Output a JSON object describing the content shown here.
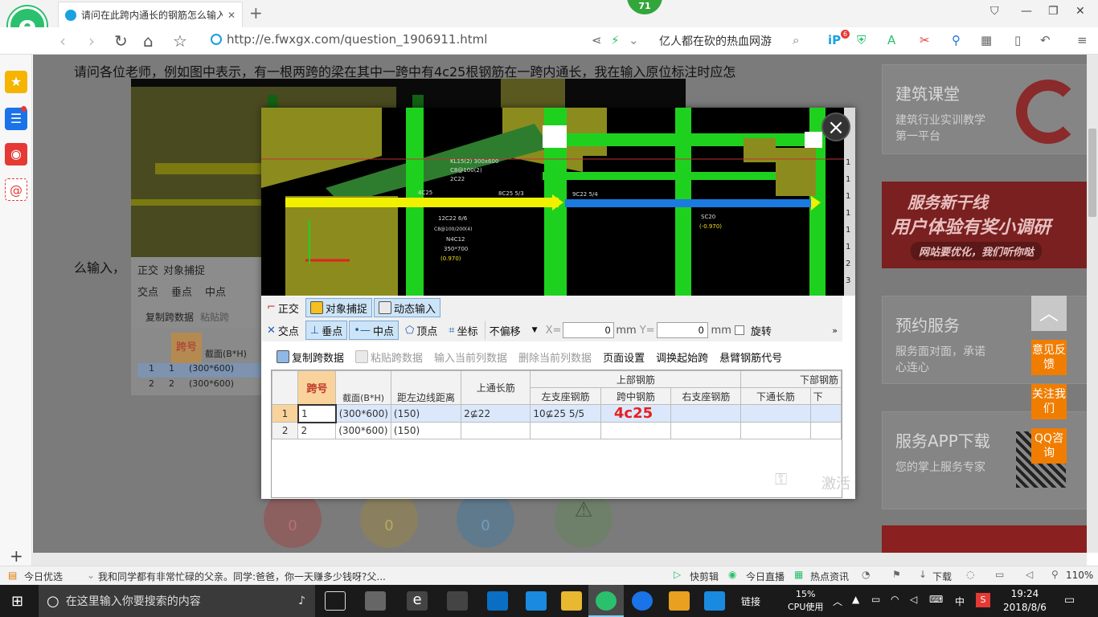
{
  "browser": {
    "tab_title": "请问在此跨内通长的钢筋怎么输入",
    "badge": "71",
    "url": "http://e.fwxgx.com/question_1906911.html",
    "search_text": "亿人都在砍的热血网游",
    "notif_count": "6"
  },
  "page": {
    "question_line": "请问各位老师，例如图中表示，有一根两跨的梁在其中一跨中有4c25根钢筋在一跨内通长，我在输入原位标注时应怎",
    "question_cont": "么输入，"
  },
  "right_panel": {
    "card1_title": "建筑课堂",
    "card1_desc": "建筑行业实训教学第一平台",
    "banner_title": "服务新干线",
    "banner_sub": "用户体验有奖小调研",
    "banner_tag": "网站要优化，我们听你哒",
    "card2_title": "预约服务",
    "card2_desc": "服务面对面，承诺心连心",
    "card3_title": "服务APP下载",
    "card3_desc": "您的掌上服务专家",
    "btn_feedback": "意见反馈",
    "btn_follow": "关注我们",
    "btn_qq": "QQ咨询"
  },
  "cad": {
    "labels": [
      "KL15(2) 300x600",
      "C8@100(2)",
      "2C22",
      "12C22 6/6",
      "C8@100/200(4)",
      "N4C12",
      "350*700",
      "(0.970)",
      "8C25 5/3",
      "9C22 5/4",
      "SC20",
      "(-0.970)",
      "4C25"
    ]
  },
  "toolbar1": {
    "ortho": "正交",
    "snap": "对象捕捉",
    "dyn": "动态输入"
  },
  "toolbar2": {
    "intersect": "交点",
    "perp": "垂点",
    "mid": "中点",
    "vertex": "顶点",
    "coord": "坐标",
    "offset": "不偏移",
    "x_label": "X=",
    "x_value": "0",
    "y_label": "Y=",
    "y_value": "0",
    "unit": "mm",
    "rotate": "旋转"
  },
  "toolbar3": {
    "copy": "复制跨数据",
    "paste": "粘贴跨数据",
    "input_col": "输入当前列数据",
    "delete_col": "删除当前列数据",
    "page_setup": "页面设置",
    "swap_start": "调换起始跨",
    "cantilever": "悬臂钢筋代号"
  },
  "table": {
    "headers": {
      "span_no": "跨号",
      "section": "截面(B*H)",
      "dist": "距左边线距离",
      "top_through": "上通长筋",
      "top_group": "上部钢筋",
      "left_seat": "左支座钢筋",
      "mid_span": "跨中钢筋",
      "right_seat": "右支座钢筋",
      "bottom_group": "下部钢筋",
      "bottom_through": "下通长筋",
      "bottom_more": "下"
    },
    "rows": [
      {
        "no": "1",
        "span": "1",
        "section": "(300*600)",
        "dist": "(150)",
        "top_through": "2⊈22",
        "left_seat": "10⊈25 5/5",
        "mid_span": "4c25",
        "right_seat": "",
        "bottom_through": ""
      },
      {
        "no": "2",
        "span": "2",
        "section": "(300*600)",
        "dist": "(150)",
        "top_through": "",
        "left_seat": "",
        "mid_span": "",
        "right_seat": "",
        "bottom_through": ""
      }
    ]
  },
  "watermark": "激活",
  "bg_table": {
    "header": "跨号",
    "section": "截面(B*H)",
    "rows": [
      [
        "1",
        "1",
        "(300*600)"
      ],
      [
        "2",
        "2",
        "(300*600)"
      ]
    ],
    "copy": "复制跨数据",
    "paste": "粘贴跨",
    "ortho": "正交",
    "snap": "对象捕捉",
    "intersect": "交点",
    "perp": "垂点",
    "mid": "中点"
  },
  "bg_counts": [
    "0",
    "0",
    "0"
  ],
  "right_num_col": [
    "1",
    "1",
    "1",
    "1",
    "1",
    "1",
    "2",
    "3"
  ],
  "statusbar": {
    "left1": "今日优选",
    "news": "我和同学都有非常忙碌的父亲。同学:爸爸，你一天赚多少钱呀?父...",
    "kuaijian": "快剪辑",
    "live": "今日直播",
    "hot": "热点资讯",
    "download": "下载",
    "zoom": "110%"
  },
  "taskbar": {
    "search_placeholder": "在这里输入你要搜索的内容",
    "link": "链接",
    "cpu_pct": "15%",
    "cpu_label": "CPU使用",
    "ime": "中",
    "time": "19:24",
    "date": "2018/8/6"
  }
}
